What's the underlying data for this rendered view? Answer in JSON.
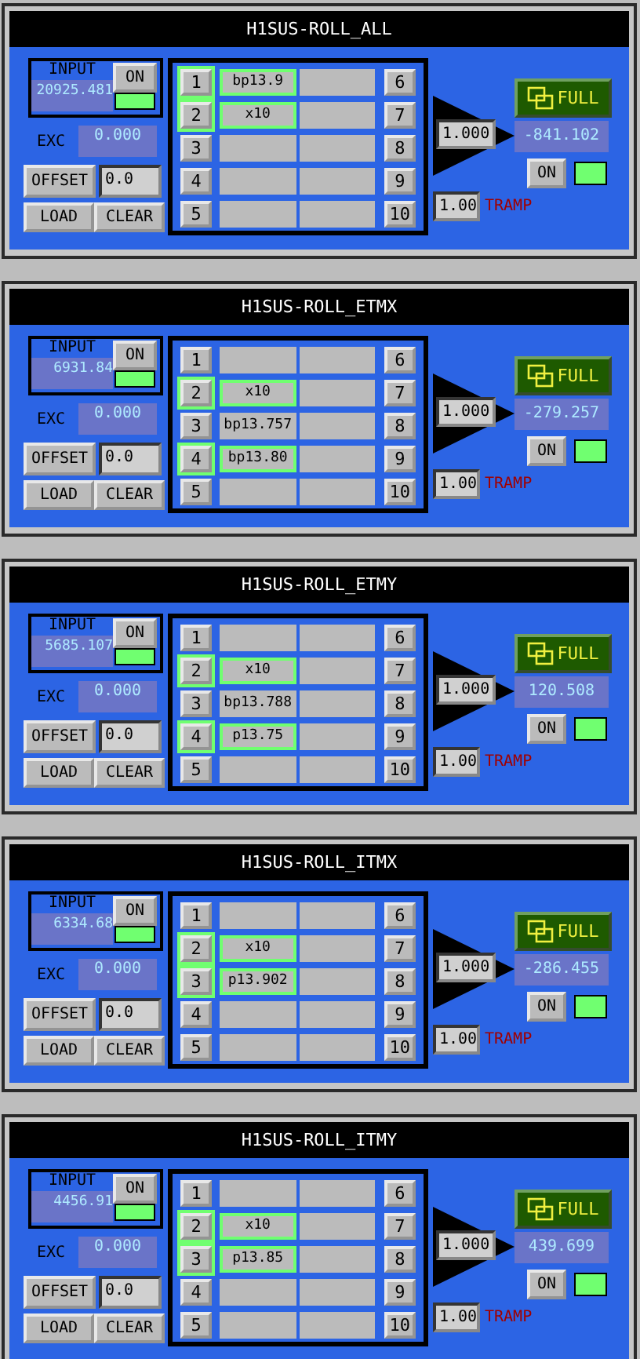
{
  "panels": [
    {
      "title": "H1SUS-ROLL_ALL",
      "input": {
        "label": "INPUT",
        "value": "20925.481",
        "switch": "ON",
        "on": true
      },
      "exc": {
        "label": "EXC",
        "value": "0.000"
      },
      "offset": {
        "button": "OFFSET",
        "value": "0.0"
      },
      "load": "LOAD",
      "clear": "CLEAR",
      "filters": [
        {
          "number": "1",
          "name": "bp13.9",
          "on": true
        },
        {
          "number": "2",
          "name": "x10",
          "on": true
        },
        {
          "number": "3",
          "on": false
        },
        {
          "number": "4",
          "on": false
        },
        {
          "number": "5",
          "on": false
        },
        {
          "number": "6",
          "on": false
        },
        {
          "number": "7",
          "on": false
        },
        {
          "number": "8",
          "on": false
        },
        {
          "number": "9",
          "on": false
        },
        {
          "number": "10",
          "on": false
        }
      ],
      "gain": "1.000",
      "output": {
        "full": "FULL",
        "value": "-841.102",
        "switch": "ON",
        "on": true
      },
      "tramp": {
        "value": "1.00",
        "label": "TRAMP"
      }
    },
    {
      "title": "H1SUS-ROLL_ETMX",
      "input": {
        "label": "INPUT",
        "value": "6931.84",
        "switch": "ON",
        "on": true
      },
      "exc": {
        "label": "EXC",
        "value": "0.000"
      },
      "offset": {
        "button": "OFFSET",
        "value": "0.0"
      },
      "load": "LOAD",
      "clear": "CLEAR",
      "filters": [
        {
          "number": "1",
          "on": false
        },
        {
          "number": "2",
          "name": "x10",
          "on": true
        },
        {
          "number": "3",
          "name": "bp13.757",
          "on": false
        },
        {
          "number": "4",
          "name": "bp13.80",
          "on": true
        },
        {
          "number": "5",
          "on": false
        },
        {
          "number": "6",
          "on": false
        },
        {
          "number": "7",
          "on": false
        },
        {
          "number": "8",
          "on": false
        },
        {
          "number": "9",
          "on": false
        },
        {
          "number": "10",
          "on": false
        }
      ],
      "gain": "1.000",
      "output": {
        "full": "FULL",
        "value": "-279.257",
        "switch": "ON",
        "on": true
      },
      "tramp": {
        "value": "1.00",
        "label": "TRAMP"
      }
    },
    {
      "title": "H1SUS-ROLL_ETMY",
      "input": {
        "label": "INPUT",
        "value": "5685.107",
        "switch": "ON",
        "on": true
      },
      "exc": {
        "label": "EXC",
        "value": "0.000"
      },
      "offset": {
        "button": "OFFSET",
        "value": "0.0"
      },
      "load": "LOAD",
      "clear": "CLEAR",
      "filters": [
        {
          "number": "1",
          "on": false
        },
        {
          "number": "2",
          "name": "x10",
          "on": true
        },
        {
          "number": "3",
          "name": "bp13.788",
          "on": false
        },
        {
          "number": "4",
          "name": "p13.75",
          "on": true
        },
        {
          "number": "5",
          "on": false
        },
        {
          "number": "6",
          "on": false
        },
        {
          "number": "7",
          "on": false
        },
        {
          "number": "8",
          "on": false
        },
        {
          "number": "9",
          "on": false
        },
        {
          "number": "10",
          "on": false
        }
      ],
      "gain": "1.000",
      "output": {
        "full": "FULL",
        "value": "120.508",
        "switch": "ON",
        "on": true
      },
      "tramp": {
        "value": "1.00",
        "label": "TRAMP"
      }
    },
    {
      "title": "H1SUS-ROLL_ITMX",
      "input": {
        "label": "INPUT",
        "value": "6334.68",
        "switch": "ON",
        "on": true
      },
      "exc": {
        "label": "EXC",
        "value": "0.000"
      },
      "offset": {
        "button": "OFFSET",
        "value": "0.0"
      },
      "load": "LOAD",
      "clear": "CLEAR",
      "filters": [
        {
          "number": "1",
          "on": false
        },
        {
          "number": "2",
          "name": "x10",
          "on": true
        },
        {
          "number": "3",
          "name": "p13.902",
          "on": true
        },
        {
          "number": "4",
          "on": false
        },
        {
          "number": "5",
          "on": false
        },
        {
          "number": "6",
          "on": false
        },
        {
          "number": "7",
          "on": false
        },
        {
          "number": "8",
          "on": false
        },
        {
          "number": "9",
          "on": false
        },
        {
          "number": "10",
          "on": false
        }
      ],
      "gain": "1.000",
      "output": {
        "full": "FULL",
        "value": "-286.455",
        "switch": "ON",
        "on": true
      },
      "tramp": {
        "value": "1.00",
        "label": "TRAMP"
      }
    },
    {
      "title": "H1SUS-ROLL_ITMY",
      "input": {
        "label": "INPUT",
        "value": "4456.91",
        "switch": "ON",
        "on": true
      },
      "exc": {
        "label": "EXC",
        "value": "0.000"
      },
      "offset": {
        "button": "OFFSET",
        "value": "0.0"
      },
      "load": "LOAD",
      "clear": "CLEAR",
      "filters": [
        {
          "number": "1",
          "on": false
        },
        {
          "number": "2",
          "name": "x10",
          "on": true
        },
        {
          "number": "3",
          "name": "p13.85",
          "on": true
        },
        {
          "number": "4",
          "on": false
        },
        {
          "number": "5",
          "on": false
        },
        {
          "number": "6",
          "on": false
        },
        {
          "number": "7",
          "on": false
        },
        {
          "number": "8",
          "on": false
        },
        {
          "number": "9",
          "on": false
        },
        {
          "number": "10",
          "on": false
        }
      ],
      "gain": "1.000",
      "output": {
        "full": "FULL",
        "value": "439.699",
        "switch": "ON",
        "on": true
      },
      "tramp": {
        "value": "1.00",
        "label": "TRAMP"
      }
    }
  ]
}
